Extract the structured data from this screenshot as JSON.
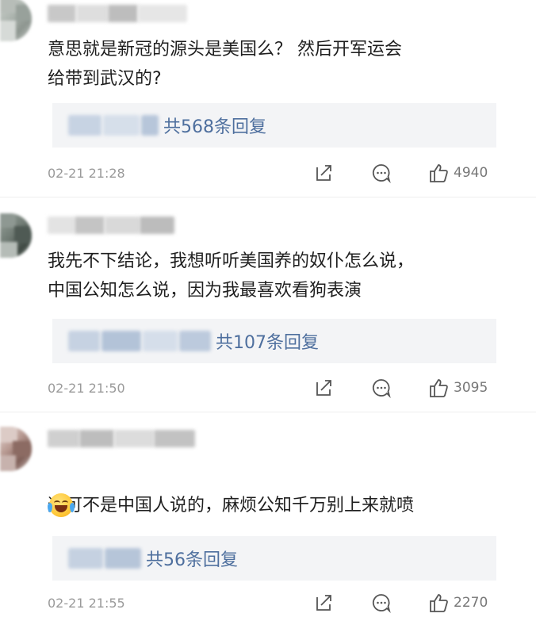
{
  "comments": [
    {
      "text": "意思就是新冠的源头是美国么？ 然后开军运会\n给带到武汉的?",
      "reply_count_label": "共568条回复",
      "time": "02-21 21:28",
      "likes": "4940"
    },
    {
      "text": "我先不下结论，我想听听美国养的奴仆怎么说，\n中国公知怎么说，因为我最喜欢看狗表演",
      "reply_count_label": "共107条回复",
      "time": "02-21 21:50",
      "likes": "3095"
    },
    {
      "text": "这可不是中国人说的，麻烦公知千万别上来就喷",
      "reply_count_label": "共56条回复",
      "time": "02-21 21:55",
      "likes": "2270",
      "emoji": "laugh-cry-emoji"
    }
  ],
  "icons": {
    "share": "share-icon",
    "comment": "comment-icon",
    "like": "like-icon"
  },
  "colors": {
    "reply_link": "#4e6f9e",
    "reply_box_bg": "#f3f4f6",
    "meta_text": "#9a9a9a"
  }
}
